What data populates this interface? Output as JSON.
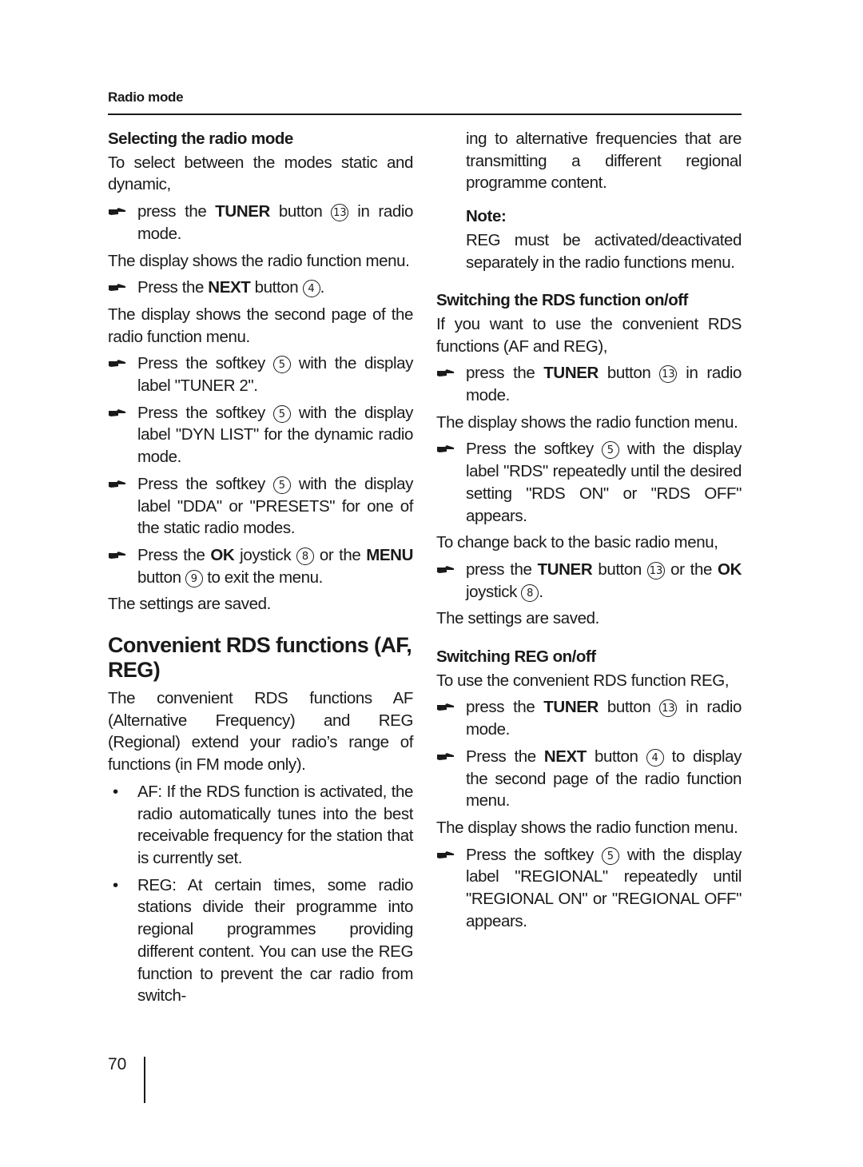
{
  "header": {
    "section": "Radio mode"
  },
  "page_number": "70",
  "left": {
    "selecting": {
      "title": "Selecting the radio mode",
      "intro": "To select between the modes static and dynamic,",
      "step1": {
        "pre": "press the ",
        "bold": "TUNER",
        "mid": " button ",
        "num": "13",
        "post": " in radio mode."
      },
      "p1": "The display shows the radio function menu.",
      "step2": {
        "pre": "Press the ",
        "bold": "NEXT",
        "mid": " button ",
        "num": "4",
        "post": "."
      },
      "p2": "The display shows the second page of the radio function menu.",
      "step3": {
        "pre": "Press the softkey ",
        "num": "5",
        "post": " with the display label \"TUNER 2\"."
      },
      "step4": {
        "pre": "Press the softkey ",
        "num": "5",
        "post": " with the display label \"DYN LIST\" for the dynamic radio mode."
      },
      "step5": {
        "pre": "Press the softkey ",
        "num": "5",
        "post": " with the display label \"DDA\" or \"PRESETS\" for one of the static radio modes."
      },
      "step6": {
        "pre": "Press the ",
        "bold1": "OK",
        "mid1": " joystick ",
        "num1": "8",
        "mid2": " or the ",
        "bold2": "MENU",
        "mid3": " button ",
        "num2": "9",
        "post": " to exit the menu."
      },
      "saved": "The settings are saved."
    },
    "rds": {
      "title": "Convenient RDS functions (AF, REG)",
      "intro": "The convenient RDS functions AF (Alternative Frequency) and REG (Regional) extend your radio’s range of functions (in FM mode only).",
      "bullets": [
        "AF: If the RDS function is activated, the radio automatically tunes into the best receivable frequency for the station that is currently set.",
        "REG: At certain times, some radio stations divide their programme into regional programmes providing different content. You can use the REG function to prevent the car radio from switch-"
      ]
    }
  },
  "right": {
    "continuation": "ing to alternative frequencies that are transmitting a different regional programme content.",
    "note": {
      "title": "Note:",
      "text": "REG must be activated/deactivated separately in the radio functions menu."
    },
    "rds_onoff": {
      "title": "Switching the RDS function on/off",
      "intro": "If you want to use the convenient RDS functions (AF and REG),",
      "step1": {
        "pre": "press the ",
        "bold": "TUNER",
        "mid": " button ",
        "num": "13",
        "post": " in radio mode."
      },
      "p1": "The display shows the radio function menu.",
      "step2": {
        "pre": "Press the softkey ",
        "num": "5",
        "post": " with the display label \"RDS\" repeatedly until the desired setting \"RDS ON\" or \"RDS OFF\" appears."
      },
      "p2": "To change back to the basic radio menu,",
      "step3": {
        "pre": "press the ",
        "bold1": "TUNER",
        "mid1": " button ",
        "num1": "13",
        "mid2": " or the ",
        "bold2": "OK",
        "mid3": " joystick ",
        "num2": "8",
        "post": "."
      },
      "saved": "The settings are saved."
    },
    "reg_onoff": {
      "title": "Switching REG on/off",
      "intro": "To use the convenient RDS function REG,",
      "step1": {
        "pre": "press the ",
        "bold": "TUNER",
        "mid": " button ",
        "num": "13",
        "post": " in radio mode."
      },
      "step2": {
        "pre": "Press the ",
        "bold": "NEXT",
        "mid": " button ",
        "num": "4",
        "post": " to display the second page of the radio function menu."
      },
      "p1": "The display shows the radio function menu.",
      "step3": {
        "pre": "Press the softkey ",
        "num": "5",
        "post": " with the display label \"REGIONAL\" repeatedly until \"REGIONAL ON\" or \"REGIONAL OFF\" appears."
      }
    }
  }
}
